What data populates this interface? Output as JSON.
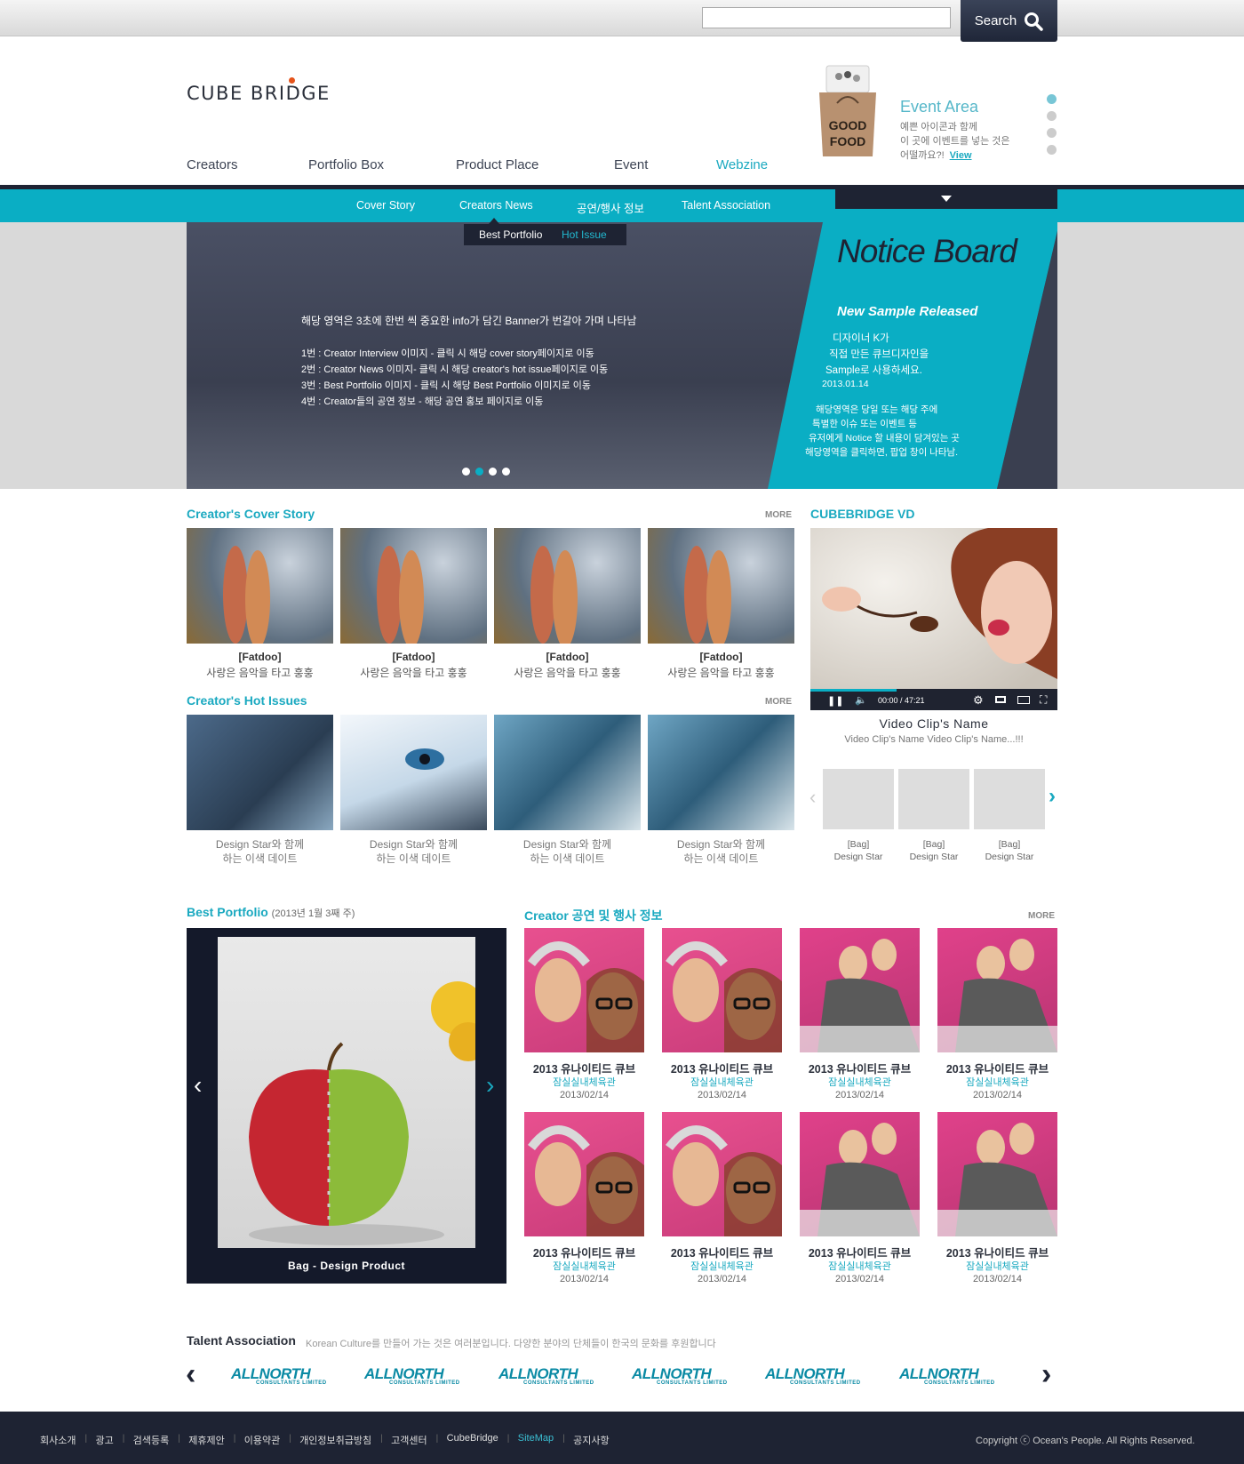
{
  "search": {
    "placeholder": "",
    "button_label": "Search"
  },
  "logo": {
    "text": "CUBE BRIDGE"
  },
  "nav": {
    "items": [
      "Creators",
      "Portfolio Box",
      "Product Place",
      "Event",
      "Webzine"
    ],
    "active": "Webzine"
  },
  "event": {
    "title": "Event Area",
    "lines": [
      "예쁜 아이콘과 함께",
      "이 곳에 이벤트를 넣는 것은",
      "어떨까요?!"
    ],
    "view_label": "View",
    "bag_text": "GOOD FOOD"
  },
  "subnav": {
    "items": [
      "Cover Story",
      "Creators News",
      "공연/행사 정보",
      "Talent Association"
    ],
    "active": "Creators News"
  },
  "subsubnav": {
    "items": [
      "Best Portfolio",
      "Hot Issue"
    ],
    "active": "Hot Issue"
  },
  "banner": {
    "headline": "해당 영역은 3초에 한번 씩 중요한 info가 담긴 Banner가 번갈아 가며 나타남",
    "lines": [
      "1번 : Creator Interview 이미지 - 클릭 시 해당 cover story페이지로 이동",
      "2번 : Creator News 이미지- 클릭 시 해당 creator's hot issue페이지로 이동",
      "3번 : Best Portfolio 이미지 - 클릭 시 해당 Best Portfolio 이미지로 이동",
      "4번 : Creator들의 공연 정보 - 해당 공연 홍보 페이지로 이동"
    ],
    "active_dot": 2
  },
  "notice": {
    "title": "Notice Board",
    "subtitle": "New Sample Released",
    "lines": [
      "디자이너 K가",
      "직접 만든 큐브디자인을",
      "Sample로 사용하세요.",
      "2013.01.14"
    ],
    "desc": [
      "해당영역은 당일 또는 해당 주에",
      "특별한 이슈 또는 이벤트 등",
      "유저에게 Notice 할 내용이 담겨있는 곳",
      "해당영역을 클릭하면, 팝업 창이 나타남."
    ]
  },
  "cover_story": {
    "title": "Creator's Cover Story",
    "more": "MORE",
    "items": [
      {
        "name": "[Fatdoo]",
        "desc": "사랑은 음악을 타고 훙훙"
      },
      {
        "name": "[Fatdoo]",
        "desc": "사랑은 음악을 타고 훙훙"
      },
      {
        "name": "[Fatdoo]",
        "desc": "사랑은 음악을 타고 훙훙"
      },
      {
        "name": "[Fatdoo]",
        "desc": "사랑은 음악을 타고 훙훙"
      }
    ]
  },
  "hot_issues": {
    "title": "Creator's Hot Issues",
    "more": "MORE",
    "items": [
      {
        "line1": "Design Star와 함께",
        "line2": "하는 이색 데이트"
      },
      {
        "line1": "Design Star와 함께",
        "line2": "하는 이색 데이트"
      },
      {
        "line1": "Design Star와 함께",
        "line2": "하는 이색 데이트"
      },
      {
        "line1": "Design Star와 함께",
        "line2": "하는 이색 데이트"
      }
    ]
  },
  "video": {
    "title": "CUBEBRIDGE VD",
    "time": "00:00 / 47:21",
    "progress": 0.35,
    "clip_name": "Video Clip's Name",
    "clip_desc": "Video Clip's Name Video Clip's Name...!!!",
    "thumbs": [
      {
        "tag": "[Bag]",
        "name": "Design Star"
      },
      {
        "tag": "[Bag]",
        "name": "Design Star"
      },
      {
        "tag": "[Bag]",
        "name": "Design Star"
      }
    ]
  },
  "portfolio": {
    "title": "Best Portfolio",
    "date": "(2013년 1월 3째 주)",
    "caption": "Bag - Design Product"
  },
  "events": {
    "title": "Creator 공연 및 행사 정보",
    "more": "MORE",
    "items": [
      {
        "title": "2013 유나이티드 큐브",
        "place": "잠실실내체육관",
        "date": "2013/02/14"
      },
      {
        "title": "2013 유나이티드 큐브",
        "place": "잠실실내체육관",
        "date": "2013/02/14"
      },
      {
        "title": "2013 유나이티드 큐브",
        "place": "잠실실내체육관",
        "date": "2013/02/14"
      },
      {
        "title": "2013 유나이티드 큐브",
        "place": "잠실실내체육관",
        "date": "2013/02/14"
      },
      {
        "title": "2013 유나이티드 큐브",
        "place": "잠실실내체육관",
        "date": "2013/02/14"
      },
      {
        "title": "2013 유나이티드 큐브",
        "place": "잠실실내체육관",
        "date": "2013/02/14"
      },
      {
        "title": "2013 유나이티드 큐브",
        "place": "잠실실내체육관",
        "date": "2013/02/14"
      },
      {
        "title": "2013 유나이티드 큐브",
        "place": "잠실실내체육관",
        "date": "2013/02/14"
      }
    ]
  },
  "talent": {
    "title": "Talent Association",
    "desc": "Korean Culture를 만들어 가는 것은 여러분입니다. 다양한 분야의 단체들이 한국의 문화를 후원합니다",
    "logos": [
      "ALLNORTH",
      "ALLNORTH",
      "ALLNORTH",
      "ALLNORTH",
      "ALLNORTH",
      "ALLNORTH"
    ],
    "logo_sub": "CONSULTANTS LIMITED"
  },
  "footer": {
    "links": [
      "회사소개",
      "광고",
      "검색등록",
      "제휴제안",
      "이용약관",
      "개인정보취급방침",
      "고객센터",
      "CubeBridge",
      "SiteMap",
      "공지사항"
    ],
    "highlight": "SiteMap",
    "copyright": "Copyright ⓒ Ocean's People. All Rights Reserved."
  },
  "colors": {
    "accent": "#0aaec4",
    "dark": "#1e2333",
    "banner": "#454b5e"
  }
}
